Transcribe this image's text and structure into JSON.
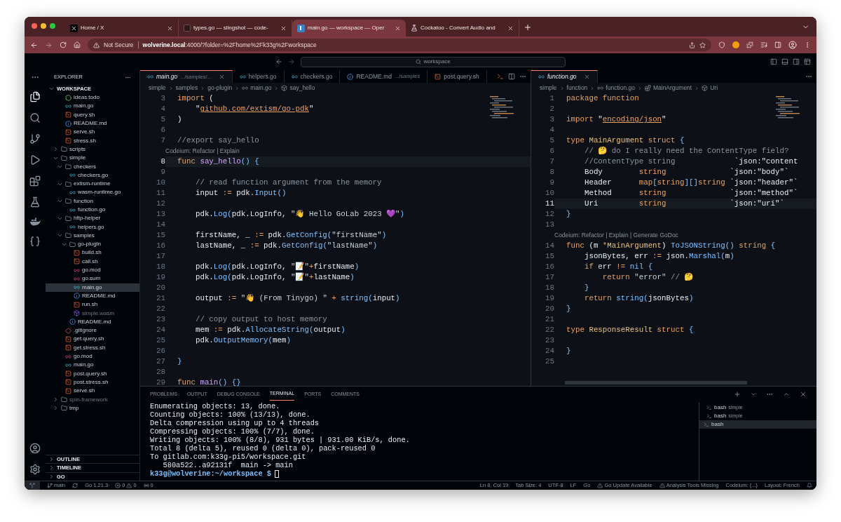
{
  "browser": {
    "tabs": [
      {
        "title": "Home / X",
        "kind": "x",
        "selected": false
      },
      {
        "title": "types.go — slingshot — code-",
        "kind": "dark",
        "selected": false
      },
      {
        "title": "main.go — workspace — Oper",
        "kind": "code",
        "selected": true
      },
      {
        "title": "Cockatoo - Convert Audio and",
        "kind": "flask",
        "selected": false
      }
    ],
    "security": "Not Secure",
    "url_host": "wolverine.local",
    "url_rest": ":4000/?folder=%2Fhome%2Fk33g%2Fworkspace"
  },
  "titlebar": {
    "search": "workspace"
  },
  "explorer": {
    "title": "EXPLORER",
    "root": "WORKSPACE",
    "tree": [
      {
        "children": [
          {
            "name": "ideas.todo",
            "kind": "todo",
            "selected": false,
            "dimmed": false
          },
          {
            "name": "main.go",
            "kind": "go",
            "selected": false,
            "dimmed": false
          },
          {
            "name": "query.sh",
            "kind": "sh",
            "selected": false,
            "dimmed": false
          },
          {
            "name": "README.md",
            "kind": "md",
            "selected": false,
            "dimmed": false
          },
          {
            "name": "serve.sh",
            "kind": "sh",
            "selected": false,
            "dimmed": false
          },
          {
            "name": "stress.sh",
            "kind": "sh",
            "selected": false,
            "dimmed": false
          }
        ]
      },
      {
        "name": "scripts",
        "kind": "folder",
        "expanded": false,
        "selected": false,
        "dimmed": false
      },
      {
        "name": "simple",
        "kind": "folder",
        "expanded": true,
        "selected": false,
        "dimmed": false,
        "children": [
          {
            "name": "checkers",
            "kind": "folder",
            "expanded": true,
            "selected": false,
            "dimmed": false,
            "children": [
              {
                "name": "checkers.go",
                "kind": "go",
                "selected": false,
                "dimmed": false
              }
            ]
          },
          {
            "name": "extism-runtime",
            "kind": "folder",
            "expanded": true,
            "selected": false,
            "dimmed": false,
            "children": [
              {
                "name": "wasm-runtime.go",
                "kind": "go",
                "selected": false,
                "dimmed": false
              }
            ]
          },
          {
            "name": "function",
            "kind": "folder",
            "expanded": true,
            "selected": false,
            "dimmed": false,
            "children": [
              {
                "name": "function.go",
                "kind": "go",
                "selected": false,
                "dimmed": false
              }
            ]
          },
          {
            "name": "http-helper",
            "kind": "folder",
            "expanded": true,
            "selected": false,
            "dimmed": false,
            "children": [
              {
                "name": "helpers.go",
                "kind": "go",
                "selected": false,
                "dimmed": false
              }
            ]
          },
          {
            "name": "samples",
            "kind": "folder",
            "expanded": true,
            "selected": false,
            "dimmed": false,
            "children": [
              {
                "name": "go-plugin",
                "kind": "folder",
                "expanded": true,
                "selected": false,
                "dimmed": false,
                "children": [
                  {
                    "name": "build.sh",
                    "kind": "sh",
                    "selected": false,
                    "dimmed": false
                  },
                  {
                    "name": "call.sh",
                    "kind": "sh",
                    "selected": false,
                    "dimmed": false
                  },
                  {
                    "name": "go.mod",
                    "kind": "mod",
                    "selected": false,
                    "dimmed": false
                  },
                  {
                    "name": "go.sum",
                    "kind": "mod",
                    "selected": false,
                    "dimmed": false
                  },
                  {
                    "name": "main.go",
                    "kind": "go",
                    "selected": true,
                    "dimmed": false
                  },
                  {
                    "name": "README.md",
                    "kind": "md",
                    "selected": false,
                    "dimmed": false
                  },
                  {
                    "name": "run.sh",
                    "kind": "sh",
                    "selected": false,
                    "dimmed": false
                  },
                  {
                    "name": "simple.wasm",
                    "kind": "wasm",
                    "selected": false,
                    "dimmed": true
                  }
                ]
              },
              {
                "name": "README.md",
                "kind": "md",
                "selected": false,
                "dimmed": false
              }
            ]
          },
          {
            "name": ".gitignore",
            "kind": "git",
            "selected": false,
            "dimmed": false
          },
          {
            "name": "get.query.sh",
            "kind": "sh",
            "selected": false,
            "dimmed": false
          },
          {
            "name": "get.stress.sh",
            "kind": "sh",
            "selected": false,
            "dimmed": false
          },
          {
            "name": "go.mod",
            "kind": "mod",
            "selected": false,
            "dimmed": false
          },
          {
            "name": "main.go",
            "kind": "go",
            "selected": false,
            "dimmed": false
          },
          {
            "name": "post.query.sh",
            "kind": "sh",
            "selected": false,
            "dimmed": false
          },
          {
            "name": "post.stress.sh",
            "kind": "sh",
            "selected": false,
            "dimmed": false
          },
          {
            "name": "serve.sh",
            "kind": "sh",
            "selected": false,
            "dimmed": false
          }
        ]
      },
      {
        "name": "spin-framework",
        "kind": "folder",
        "expanded": false,
        "selected": false,
        "dimmed": true
      },
      {
        "name": "tmp",
        "kind": "folder",
        "expanded": false,
        "selected": false,
        "dimmed": false
      }
    ],
    "sections": [
      "OUTLINE",
      "TIMELINE",
      "GO"
    ]
  },
  "left_editor": {
    "tabs": [
      {
        "name": "main.go",
        "path": ".../samples/...",
        "kind": "go",
        "selected": true
      },
      {
        "name": "helpers.go",
        "kind": "go",
        "selected": false
      },
      {
        "name": "checkers.go",
        "kind": "go",
        "selected": false
      },
      {
        "name": "README.md",
        "path": ".../samples",
        "kind": "md",
        "selected": false
      },
      {
        "name": "post.query.sh",
        "kind": "sh",
        "selected": false
      }
    ],
    "breadcrumbs": [
      "simple",
      "samples",
      "go-plugin",
      "main.go",
      "say_hello"
    ],
    "lines": [
      {
        "kind": "code",
        "number": "3",
        "current": false,
        "tokens": [
          {
            "kind": "kw",
            "text": "import"
          },
          {
            "kind": "pl",
            "text": " ("
          }
        ]
      },
      {
        "kind": "code",
        "number": "4",
        "current": false,
        "tokens": [
          {
            "kind": "pl",
            "text": "    \""
          },
          {
            "kind": "ln",
            "text": "github.com/extism/go-pdk"
          },
          {
            "kind": "pl",
            "text": "\""
          }
        ]
      },
      {
        "kind": "code",
        "number": "5",
        "current": false,
        "tokens": [
          {
            "kind": "pl",
            "text": ")"
          }
        ]
      },
      {
        "kind": "code",
        "number": "6",
        "current": false
      },
      {
        "kind": "code",
        "number": "7",
        "current": false,
        "tokens": [
          {
            "kind": "cm",
            "text": "//export say_hello"
          }
        ]
      },
      {
        "kind": "codelens",
        "text": "Codeium: Refactor | Explain"
      },
      {
        "kind": "code",
        "number": "8",
        "current": true,
        "tokens": [
          {
            "kind": "kw",
            "text": "func "
          },
          {
            "kind": "fn",
            "text": "say_hello"
          },
          {
            "kind": "br",
            "text": "() {"
          }
        ]
      },
      {
        "kind": "code",
        "number": "9",
        "current": false
      },
      {
        "kind": "code",
        "number": "10",
        "current": false,
        "tokens": [
          {
            "kind": "cm",
            "text": "    // read function argument from the memory"
          }
        ]
      },
      {
        "kind": "code",
        "number": "11",
        "current": false,
        "tokens": [
          {
            "kind": "pl",
            "text": "    input "
          },
          {
            "kind": "op",
            "text": ":="
          },
          {
            "kind": "pl",
            "text": " pdk."
          },
          {
            "kind": "me",
            "text": "Input"
          },
          {
            "kind": "br",
            "text": "()"
          }
        ]
      },
      {
        "kind": "code",
        "number": "12",
        "current": false
      },
      {
        "kind": "code",
        "number": "13",
        "current": false,
        "tokens": [
          {
            "kind": "pl",
            "text": "    pdk."
          },
          {
            "kind": "me",
            "text": "Log"
          },
          {
            "kind": "br",
            "text": "("
          },
          {
            "kind": "pl",
            "text": "pdk.LogInfo, "
          },
          {
            "kind": "st",
            "text": "\"👋 Hello GoLab 2023 💜\""
          },
          {
            "kind": "br",
            "text": ")"
          }
        ]
      },
      {
        "kind": "code",
        "number": "14",
        "current": false
      },
      {
        "kind": "code",
        "number": "15",
        "current": false,
        "tokens": [
          {
            "kind": "pl",
            "text": "    firstName, _ "
          },
          {
            "kind": "op",
            "text": ":="
          },
          {
            "kind": "pl",
            "text": " pdk."
          },
          {
            "kind": "me",
            "text": "GetConfig"
          },
          {
            "kind": "br",
            "text": "("
          },
          {
            "kind": "st",
            "text": "\"firstName\""
          },
          {
            "kind": "br",
            "text": ")"
          }
        ]
      },
      {
        "kind": "code",
        "number": "16",
        "current": false,
        "tokens": [
          {
            "kind": "pl",
            "text": "    lastName, _ "
          },
          {
            "kind": "op",
            "text": ":="
          },
          {
            "kind": "pl",
            "text": " pdk."
          },
          {
            "kind": "me",
            "text": "GetConfig"
          },
          {
            "kind": "br",
            "text": "("
          },
          {
            "kind": "st",
            "text": "\"lastName\""
          },
          {
            "kind": "br",
            "text": ")"
          }
        ]
      },
      {
        "kind": "code",
        "number": "17",
        "current": false
      },
      {
        "kind": "code",
        "number": "18",
        "current": false,
        "tokens": [
          {
            "kind": "pl",
            "text": "    pdk."
          },
          {
            "kind": "me",
            "text": "Log"
          },
          {
            "kind": "br",
            "text": "("
          },
          {
            "kind": "pl",
            "text": "pdk.LogInfo, "
          },
          {
            "kind": "st",
            "text": "\"📝\""
          },
          {
            "kind": "op",
            "text": "+"
          },
          {
            "kind": "pl",
            "text": "firstName"
          },
          {
            "kind": "br",
            "text": ")"
          }
        ]
      },
      {
        "kind": "code",
        "number": "19",
        "current": false,
        "tokens": [
          {
            "kind": "pl",
            "text": "    pdk."
          },
          {
            "kind": "me",
            "text": "Log"
          },
          {
            "kind": "br",
            "text": "("
          },
          {
            "kind": "pl",
            "text": "pdk.LogInfo, "
          },
          {
            "kind": "st",
            "text": "\"📝\""
          },
          {
            "kind": "op",
            "text": "+"
          },
          {
            "kind": "pl",
            "text": "lastName"
          },
          {
            "kind": "br",
            "text": ")"
          }
        ]
      },
      {
        "kind": "code",
        "number": "20",
        "current": false
      },
      {
        "kind": "code",
        "number": "21",
        "current": false,
        "tokens": [
          {
            "kind": "pl",
            "text": "    output "
          },
          {
            "kind": "op",
            "text": ":="
          },
          {
            "kind": "st",
            "text": " \"👋 (From Tinygo) \" "
          },
          {
            "kind": "op",
            "text": "+ "
          },
          {
            "kind": "me",
            "text": "string"
          },
          {
            "kind": "br",
            "text": "("
          },
          {
            "kind": "pl",
            "text": "input"
          },
          {
            "kind": "br",
            "text": ")"
          }
        ]
      },
      {
        "kind": "code",
        "number": "22",
        "current": false
      },
      {
        "kind": "code",
        "number": "23",
        "current": false,
        "tokens": [
          {
            "kind": "cm",
            "text": "    // copy output to host memory"
          }
        ]
      },
      {
        "kind": "code",
        "number": "24",
        "current": false,
        "tokens": [
          {
            "kind": "pl",
            "text": "    mem "
          },
          {
            "kind": "op",
            "text": ":="
          },
          {
            "kind": "pl",
            "text": " pdk."
          },
          {
            "kind": "me",
            "text": "AllocateString"
          },
          {
            "kind": "br",
            "text": "("
          },
          {
            "kind": "pl",
            "text": "output"
          },
          {
            "kind": "br",
            "text": ")"
          }
        ]
      },
      {
        "kind": "code",
        "number": "25",
        "current": false,
        "tokens": [
          {
            "kind": "pl",
            "text": "    pdk."
          },
          {
            "kind": "me",
            "text": "OutputMemory"
          },
          {
            "kind": "br",
            "text": "("
          },
          {
            "kind": "pl",
            "text": "mem"
          },
          {
            "kind": "br",
            "text": ")"
          }
        ]
      },
      {
        "kind": "code",
        "number": "26",
        "current": false
      },
      {
        "kind": "code",
        "number": "27",
        "current": false,
        "tokens": [
          {
            "kind": "br",
            "text": "}"
          }
        ]
      },
      {
        "kind": "code",
        "number": "28",
        "current": false
      },
      {
        "kind": "code",
        "number": "29",
        "current": false,
        "tokens": [
          {
            "kind": "kw",
            "text": "func "
          },
          {
            "kind": "fn",
            "text": "main"
          },
          {
            "kind": "br",
            "text": "() {}"
          }
        ]
      }
    ]
  },
  "right_editor": {
    "tabs": [
      {
        "name": "function.go",
        "kind": "go",
        "selected": true
      }
    ],
    "breadcrumbs": [
      "simple",
      "function",
      "function.go",
      "MainArgument",
      "Uri"
    ],
    "lines": [
      {
        "kind": "code",
        "number": "1",
        "current": false,
        "tokens": [
          {
            "kind": "kw",
            "text": "package function"
          }
        ]
      },
      {
        "kind": "code",
        "number": "2",
        "current": false
      },
      {
        "kind": "code",
        "number": "3",
        "current": false,
        "tokens": [
          {
            "kind": "kw",
            "text": "import"
          },
          {
            "kind": "pl",
            "text": " \""
          },
          {
            "kind": "ln",
            "text": "encoding/json"
          },
          {
            "kind": "pl",
            "text": "\""
          }
        ]
      },
      {
        "kind": "code",
        "number": "4",
        "current": false
      },
      {
        "kind": "code",
        "number": "5",
        "current": false,
        "tokens": [
          {
            "kind": "kw",
            "text": "type "
          },
          {
            "kind": "ty",
            "text": "MainArgument "
          },
          {
            "kind": "kw",
            "text": "struct "
          },
          {
            "kind": "br",
            "text": "{"
          }
        ]
      },
      {
        "kind": "code",
        "number": "6",
        "current": false,
        "tokens": [
          {
            "kind": "cm",
            "text": "    // 🤔 do I really need the ContentType field?"
          }
        ]
      },
      {
        "kind": "code",
        "number": "7",
        "current": false,
        "tokens": [
          {
            "kind": "cm",
            "text": "    //ContentType string"
          },
          {
            "kind": "pl",
            "text": "             `json:\"content"
          }
        ]
      },
      {
        "kind": "code",
        "number": "8",
        "current": false,
        "tokens": [
          {
            "kind": "pl",
            "text": "    Body        "
          },
          {
            "kind": "kw",
            "text": "string"
          },
          {
            "kind": "pl",
            "text": "              `json:\"body\"`"
          }
        ]
      },
      {
        "kind": "code",
        "number": "9",
        "current": false,
        "tokens": [
          {
            "kind": "pl",
            "text": "    Header      "
          },
          {
            "kind": "kw",
            "text": "map"
          },
          {
            "kind": "br",
            "text": "["
          },
          {
            "kind": "kw",
            "text": "string"
          },
          {
            "kind": "br",
            "text": "][]"
          },
          {
            "kind": "kw",
            "text": "string"
          },
          {
            "kind": "pl",
            "text": " `json:\"header\"`"
          }
        ]
      },
      {
        "kind": "code",
        "number": "10",
        "current": false,
        "tokens": [
          {
            "kind": "pl",
            "text": "    Method      "
          },
          {
            "kind": "kw",
            "text": "string"
          },
          {
            "kind": "pl",
            "text": "              `json:\"method\"`"
          }
        ]
      },
      {
        "kind": "code",
        "number": "11",
        "current": true,
        "tokens": [
          {
            "kind": "pl",
            "text": "    Uri         "
          },
          {
            "kind": "kw",
            "text": "string"
          },
          {
            "kind": "pl",
            "text": "              `json:\"uri\"`"
          }
        ]
      },
      {
        "kind": "code",
        "number": "12",
        "current": false,
        "tokens": [
          {
            "kind": "br",
            "text": "}"
          }
        ]
      },
      {
        "kind": "code",
        "number": "13",
        "current": false
      },
      {
        "kind": "codelens",
        "text": "Codeium: Refactor | Explain | Generate GoDoc"
      },
      {
        "kind": "code",
        "number": "14",
        "current": false,
        "tokens": [
          {
            "kind": "kw",
            "text": "func"
          },
          {
            "kind": "pl",
            "text": " (m "
          },
          {
            "kind": "op",
            "text": "*"
          },
          {
            "kind": "ty",
            "text": "MainArgument"
          },
          {
            "kind": "pl",
            "text": ") "
          },
          {
            "kind": "me",
            "text": "ToJSONString"
          },
          {
            "kind": "br",
            "text": "() "
          },
          {
            "kind": "kw",
            "text": "string "
          },
          {
            "kind": "br",
            "text": "{"
          }
        ]
      },
      {
        "kind": "code",
        "number": "15",
        "current": false,
        "tokens": [
          {
            "kind": "pl",
            "text": "    jsonBytes, err "
          },
          {
            "kind": "op",
            "text": ":="
          },
          {
            "kind": "pl",
            "text": " json."
          },
          {
            "kind": "me",
            "text": "Marshal"
          },
          {
            "kind": "br",
            "text": "("
          },
          {
            "kind": "pl",
            "text": "m"
          },
          {
            "kind": "br",
            "text": ")"
          }
        ]
      },
      {
        "kind": "code",
        "number": "16",
        "current": false,
        "tokens": [
          {
            "kind": "kw",
            "text": "    if"
          },
          {
            "kind": "pl",
            "text": " err "
          },
          {
            "kind": "op",
            "text": "!="
          },
          {
            "kind": "me",
            "text": " nil "
          },
          {
            "kind": "br",
            "text": "{"
          }
        ]
      },
      {
        "kind": "code",
        "number": "17",
        "current": false,
        "tokens": [
          {
            "kind": "kw",
            "text": "        return"
          },
          {
            "kind": "st",
            "text": " \"error\" "
          },
          {
            "kind": "cm",
            "text": "// 🤔"
          }
        ]
      },
      {
        "kind": "code",
        "number": "18",
        "current": false,
        "tokens": [
          {
            "kind": "br",
            "text": "    }"
          }
        ]
      },
      {
        "kind": "code",
        "number": "19",
        "current": false,
        "tokens": [
          {
            "kind": "kw",
            "text": "    return "
          },
          {
            "kind": "me",
            "text": "string"
          },
          {
            "kind": "br",
            "text": "("
          },
          {
            "kind": "pl",
            "text": "jsonBytes"
          },
          {
            "kind": "br",
            "text": ")"
          }
        ]
      },
      {
        "kind": "code",
        "number": "20",
        "current": false,
        "tokens": [
          {
            "kind": "br",
            "text": "}"
          }
        ]
      },
      {
        "kind": "code",
        "number": "21",
        "current": false
      },
      {
        "kind": "code",
        "number": "22",
        "current": false,
        "tokens": [
          {
            "kind": "kw",
            "text": "type "
          },
          {
            "kind": "ty",
            "text": "ResponseResult "
          },
          {
            "kind": "kw",
            "text": "struct "
          },
          {
            "kind": "br",
            "text": "{"
          }
        ]
      },
      {
        "kind": "code",
        "number": "23",
        "current": false
      },
      {
        "kind": "code",
        "number": "24",
        "current": false,
        "tokens": [
          {
            "kind": "br",
            "text": "}"
          }
        ]
      },
      {
        "kind": "code",
        "number": "25",
        "current": false
      }
    ]
  },
  "panel": {
    "tabs": [
      {
        "label": "PROBLEMS",
        "selected": false
      },
      {
        "label": "OUTPUT",
        "selected": false
      },
      {
        "label": "DEBUG CONSOLE",
        "selected": false
      },
      {
        "label": "TERMINAL",
        "selected": true
      },
      {
        "label": "PORTS",
        "selected": false
      },
      {
        "label": "COMMENTS",
        "selected": false
      }
    ],
    "terminal": [
      "Enumerating objects: 13, done.",
      "Counting objects: 100% (13/13), done.",
      "Delta compression using up to 4 threads",
      "Compressing objects: 100% (7/7), done.",
      "Writing objects: 100% (8/8), 931 bytes | 931.00 KiB/s, done.",
      "Total 8 (delta 5), reused 0 (delta 0), pack-reused 0",
      "To gitlab.com:k33g-pi5/workspace.git",
      "   580a522..a92131f  main -> main"
    ],
    "prompt": "k33g@wolverine:~/workspace $",
    "terminals": [
      {
        "name": "bash",
        "folder": "simple",
        "selected": false
      },
      {
        "name": "bash",
        "folder": "simple",
        "selected": false
      },
      {
        "name": "bash",
        "selected": true
      }
    ]
  },
  "status_bar": {
    "branch": "main",
    "go_version": "Go 1.21.3",
    "errors": "0",
    "warnings": "0",
    "ports": "0",
    "right": [
      {
        "text": "Ln 8, Col 19",
        "kind": "plain"
      },
      {
        "text": "Tab Size: 4",
        "kind": "plain"
      },
      {
        "text": "UTF-8",
        "kind": "plain"
      },
      {
        "text": "LF",
        "kind": "plain"
      },
      {
        "text": "Go",
        "kind": "plain"
      },
      {
        "text": "Go Update Available",
        "kind": "warning"
      },
      {
        "text": "Analysis Tools Missing",
        "kind": "warning"
      },
      {
        "text": "Codeium: {...}",
        "kind": "plain"
      },
      {
        "text": "Layout: French",
        "kind": "plain"
      }
    ]
  }
}
